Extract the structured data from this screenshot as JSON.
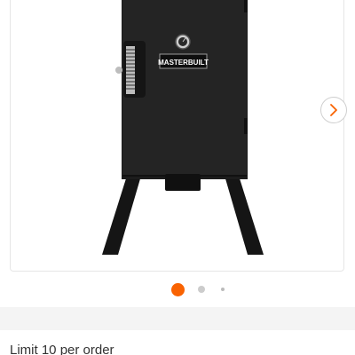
{
  "product": {
    "image_alt": "Masterbuilt electric smoker",
    "brand_logo_text": "MASTERBUILT"
  },
  "carousel": {
    "next_icon": "chevron-right-icon",
    "slide_count": 3,
    "active_slide": 1
  },
  "purchase": {
    "limit_text": "Limit 10 per order"
  },
  "colors": {
    "accent": "#f96302",
    "inactive_dot": "#cccccc"
  }
}
